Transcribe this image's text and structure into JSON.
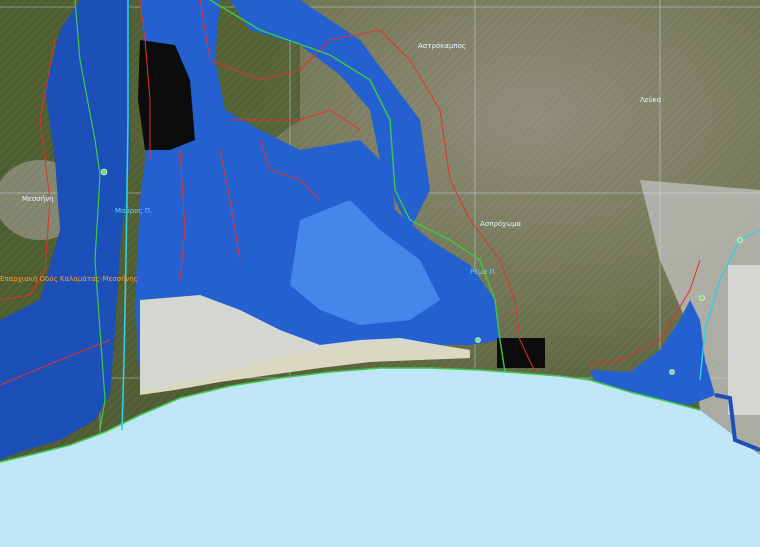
{
  "map": {
    "colors": {
      "sea": "#bfe6f8",
      "land_dark": "#4e5c35",
      "land_light": "#8a8a72",
      "flood_deep": "#1848b0",
      "flood_mid": "#2a6ee0",
      "flood_light": "#5aa8ff",
      "boundary_red": "#e2312b",
      "boundary_green": "#3ec84a",
      "road_cyan": "#2fd0e8",
      "black_zone": "#0b0b0b",
      "urban": "#c9c9c9"
    },
    "labels": {
      "place_1": "Αστρόκαμπος",
      "place_2": "Λεύκα",
      "place_3": "Μεσσήνη",
      "place_4": "Ασπρόχωμα",
      "road_1": "Μαύρος Π.",
      "road_2": "Ρέμα Π.",
      "road_orange": "Επαρχιακή Οδός Καλαμάτας-Μεσσήνης"
    }
  }
}
